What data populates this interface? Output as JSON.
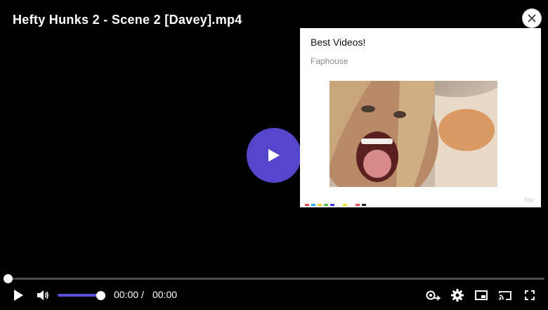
{
  "video": {
    "title": "Hefty Hunks 2 - Scene 2 [Davey].mp4",
    "current_time": "00:00",
    "separator": "/",
    "duration": "00:00",
    "progress": 0,
    "volume": 1.0
  },
  "ad": {
    "title": "Best Videos!",
    "brand": "Faphouse",
    "watermark": "htv"
  },
  "icons": {
    "big_play": "play-icon",
    "close": "close-icon",
    "play": "play-icon",
    "volume": "volume-icon",
    "quality": "hd-quality-icon",
    "settings": "gear-icon",
    "pip": "picture-in-picture-icon",
    "cast": "cast-icon",
    "fullscreen": "fullscreen-icon"
  },
  "colors": {
    "accent": "#5646cc",
    "volume_fill": "#5b4fd8",
    "background": "#000000"
  }
}
